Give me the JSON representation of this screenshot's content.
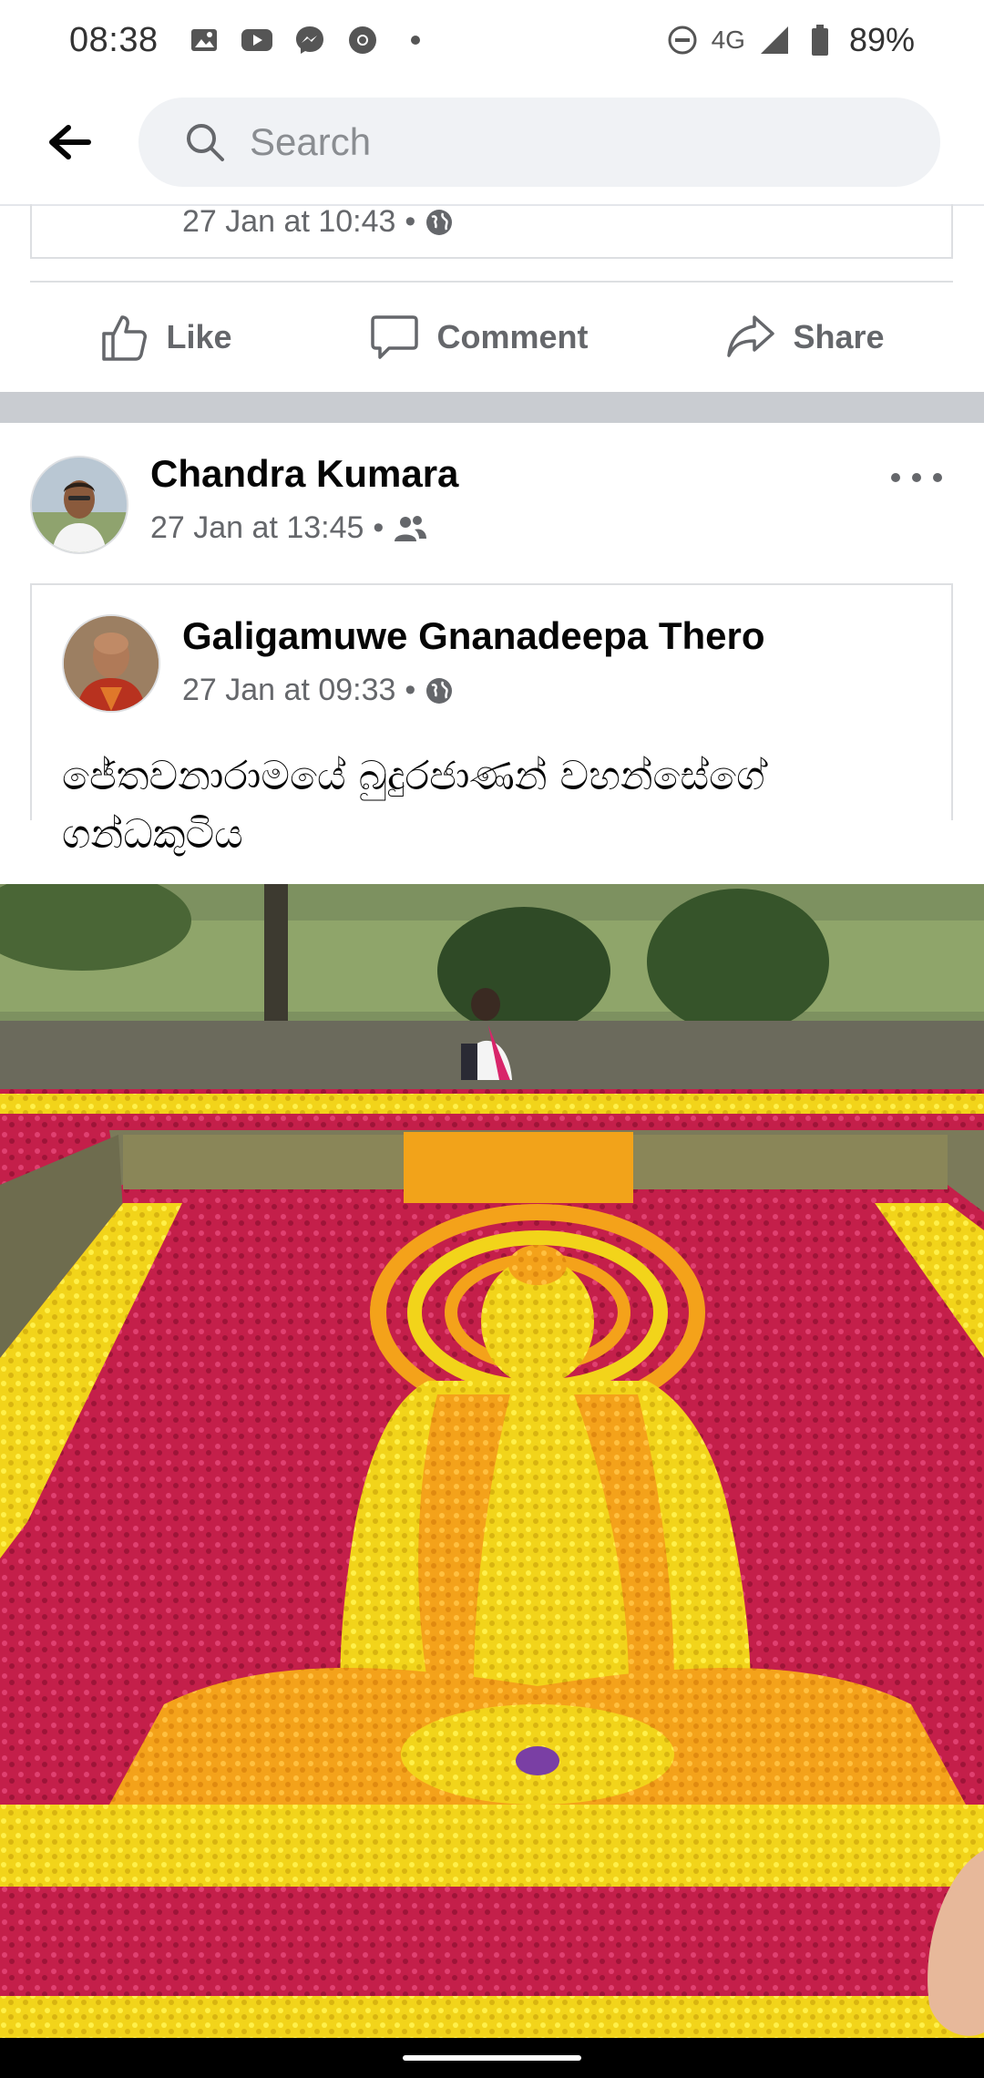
{
  "status_bar": {
    "time": "08:38",
    "network": "4G",
    "battery": "89%"
  },
  "search": {
    "placeholder": "Search"
  },
  "previous_post": {
    "timestamp": "27 Jan at 10:43",
    "separator": "•"
  },
  "actions": {
    "like": "Like",
    "comment": "Comment",
    "share": "Share"
  },
  "post": {
    "author": "Chandra Kumara",
    "timestamp": "27 Jan at 13:45",
    "separator": "•",
    "audience_icon": "friends-icon",
    "shared": {
      "author": "Galigamuwe Gnanadeepa Thero",
      "timestamp": "27 Jan at 09:33",
      "separator": "•",
      "audience_icon": "globe-icon",
      "text": "ජේතවනාරාමයේ බුදුරජාණන් වහන්සේගේ ගන්ධකුටිය"
    }
  },
  "colors": {
    "accent": "#1877f2",
    "secondary_text": "#65676b",
    "divider": "#c9ccd1"
  }
}
